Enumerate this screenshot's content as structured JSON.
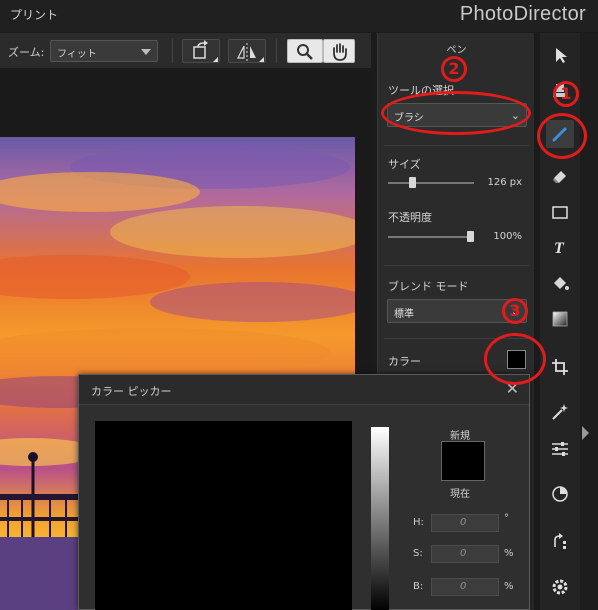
{
  "titlebar": {
    "menu": "プリント",
    "app_name": "PhotoDirector"
  },
  "toolbar": {
    "zoom_label": "ズーム:",
    "zoom_value": "フィット"
  },
  "panel": {
    "title": "ペン",
    "tool_select_label": "ツールの選択",
    "tool_select_value": "ブラシ",
    "size_label": "サイズ",
    "size_value": "126 px",
    "opacity_label": "不透明度",
    "opacity_value": "100%",
    "blend_label": "ブレンド モード",
    "blend_value": "標準",
    "color_label": "カラー",
    "color_hex": "#000000"
  },
  "sliders": {
    "size_fraction": 0.26,
    "opacity_fraction": 1.0
  },
  "rail": {
    "items": [
      "select-arrow-icon",
      "stamp-icon",
      "pen-icon",
      "eraser-icon",
      "rectangle-icon",
      "text-icon",
      "fill-bucket-icon",
      "gradient-icon",
      "crop-icon",
      "magic-wand-icon",
      "adjust-sliders-icon",
      "tone-icon",
      "rotate-icon",
      "gear-icon"
    ]
  },
  "dialog": {
    "title": "カラー ピッカー",
    "new_label": "新規",
    "current_label": "現在",
    "h_label": "H:",
    "h_value": "0",
    "h_unit": "°",
    "s_label": "S:",
    "s_value": "0",
    "s_unit": "%",
    "b_label": "B:",
    "b_value": "0",
    "b_unit": "%"
  },
  "annotations": {
    "n1": "1",
    "n2": "2",
    "n3": "3"
  },
  "colors": {
    "accent": "#3a7bd5",
    "annotation": "#e01c1c"
  }
}
